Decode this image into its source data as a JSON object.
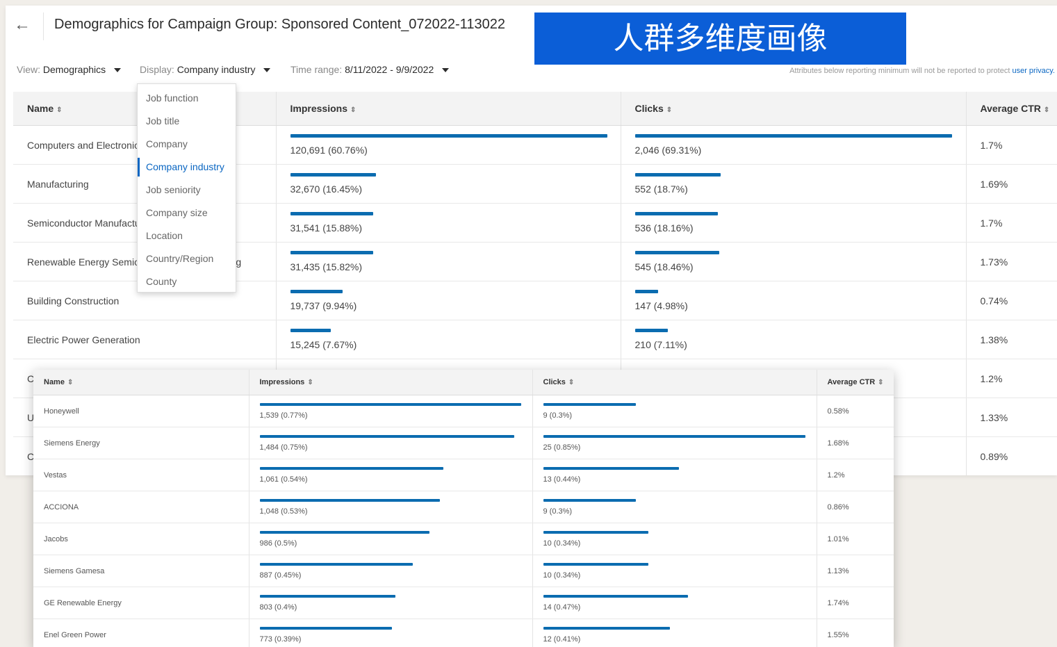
{
  "header": {
    "back_icon": "arrow-left-icon",
    "title": "Demographics for Campaign Group: Sponsored Content_072022-113022"
  },
  "filters": {
    "view_label": "View:",
    "view_value": "Demographics",
    "display_label": "Display:",
    "display_value": "Company industry",
    "time_label": "Time range:",
    "time_value": "8/11/2022 - 9/9/2022"
  },
  "privacy": {
    "text": "Attributes below reporting minimum will not be reported to protect",
    "link": "user privacy."
  },
  "banner": {
    "text": "人群多维度画像"
  },
  "colors": {
    "bar": "#0b6cb0",
    "accent": "#0a66c2",
    "banner": "#0b5ed7"
  },
  "main_table": {
    "columns": [
      "Name",
      "Impressions",
      "Clicks",
      "Average CTR"
    ],
    "rows": [
      {
        "name": "Computers and Electronics Manufacturing",
        "impressions": "120,691 (60.76%)",
        "imp_share": 0.6076,
        "clicks": "2,046 (69.31%)",
        "click_share": 0.6931,
        "ctr": "1.7%"
      },
      {
        "name": "Manufacturing",
        "impressions": "32,670 (16.45%)",
        "imp_share": 0.1645,
        "clicks": "552 (18.7%)",
        "click_share": 0.187,
        "ctr": "1.69%"
      },
      {
        "name": "Semiconductor Manufacturing",
        "impressions": "31,541 (15.88%)",
        "imp_share": 0.1588,
        "clicks": "536 (18.16%)",
        "click_share": 0.1816,
        "ctr": "1.7%"
      },
      {
        "name": "Renewable Energy Semiconductor Manufacturing",
        "impressions": "31,435 (15.82%)",
        "imp_share": 0.1582,
        "clicks": "545 (18.46%)",
        "click_share": 0.1846,
        "ctr": "1.73%"
      },
      {
        "name": "Building Construction",
        "impressions": "19,737 (9.94%)",
        "imp_share": 0.0994,
        "clicks": "147 (4.98%)",
        "click_share": 0.0498,
        "ctr": "0.74%"
      },
      {
        "name": "Electric Power Generation",
        "impressions": "15,245 (7.67%)",
        "imp_share": 0.0767,
        "clicks": "210 (7.11%)",
        "click_share": 0.0711,
        "ctr": "1.38%"
      },
      {
        "name": "C",
        "impressions": "",
        "imp_share": 0.05,
        "clicks": "",
        "click_share": 0.06,
        "ctr": "1.2%"
      },
      {
        "name": "U",
        "impressions": "",
        "imp_share": 0,
        "clicks": "",
        "click_share": 0,
        "ctr": "1.33%"
      },
      {
        "name": "C",
        "impressions": "",
        "imp_share": 0,
        "clicks": "",
        "click_share": 0,
        "ctr": "0.89%"
      }
    ]
  },
  "dropdown": {
    "options": [
      "Job function",
      "Job title",
      "Company",
      "Company industry",
      "Job seniority",
      "Company size",
      "Location",
      "Country/Region",
      "County"
    ],
    "selected": "Company industry"
  },
  "overlay_table": {
    "columns": [
      "Name",
      "Impressions",
      "Clicks",
      "Average CTR"
    ],
    "rows": [
      {
        "name": "Honeywell",
        "impressions": "1,539 (0.77%)",
        "imp_share": 0.77,
        "clicks": "9 (0.3%)",
        "click_share": 0.3,
        "ctr": "0.58%"
      },
      {
        "name": "Siemens Energy",
        "impressions": "1,484 (0.75%)",
        "imp_share": 0.75,
        "clicks": "25 (0.85%)",
        "click_share": 0.85,
        "ctr": "1.68%"
      },
      {
        "name": "Vestas",
        "impressions": "1,061 (0.54%)",
        "imp_share": 0.54,
        "clicks": "13 (0.44%)",
        "click_share": 0.44,
        "ctr": "1.2%"
      },
      {
        "name": "ACCIONA",
        "impressions": "1,048 (0.53%)",
        "imp_share": 0.53,
        "clicks": "9 (0.3%)",
        "click_share": 0.3,
        "ctr": "0.86%"
      },
      {
        "name": "Jacobs",
        "impressions": "986 (0.5%)",
        "imp_share": 0.5,
        "clicks": "10 (0.34%)",
        "click_share": 0.34,
        "ctr": "1.01%"
      },
      {
        "name": "Siemens Gamesa",
        "impressions": "887 (0.45%)",
        "imp_share": 0.45,
        "clicks": "10 (0.34%)",
        "click_share": 0.34,
        "ctr": "1.13%"
      },
      {
        "name": "GE Renewable Energy",
        "impressions": "803 (0.4%)",
        "imp_share": 0.4,
        "clicks": "14 (0.47%)",
        "click_share": 0.47,
        "ctr": "1.74%"
      },
      {
        "name": "Enel Green Power",
        "impressions": "773 (0.39%)",
        "imp_share": 0.39,
        "clicks": "12 (0.41%)",
        "click_share": 0.41,
        "ctr": "1.55%"
      }
    ]
  }
}
